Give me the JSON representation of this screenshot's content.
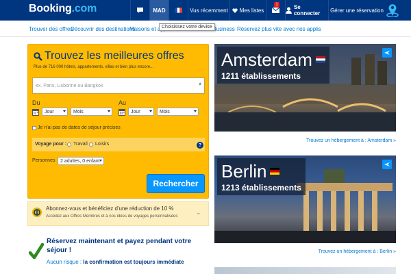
{
  "header": {
    "logo_main": "Booking",
    "logo_suffix": ".com",
    "currency": "MAD",
    "recent": "Vus récemment",
    "lists": "Mes listes",
    "inbox_count": "1",
    "login": "Se connecter",
    "manage": "Gérer une réservation"
  },
  "subnav": {
    "items": [
      "Trouver des offres",
      "Découvrir des destinations",
      "Maisons et app",
      "com Business",
      "Réservez plus vite avec nos applis"
    ],
    "tooltip": "Choisissez votre devise"
  },
  "search": {
    "title": "Trouvez les meilleures offres",
    "subtitle": "Plus de 716 000 hôtels, appartements, villas et bien plus encore...",
    "destination_placeholder": "ex. Paris, Lisbonne ou Bangkok",
    "required_mark": "*",
    "checkin_label": "Du",
    "checkout_label": "Au",
    "day_label": "Jour",
    "month_label": "Mois",
    "no_dates_label": "Je n'ai pas de dates de séjour précises",
    "travel_purpose_label": "Voyage pour :",
    "purpose_work": "Travail",
    "purpose_leisure": "Loisirs",
    "help": "?",
    "persons_label": "Personnes",
    "persons_value": "2 adultes, 0 enfant",
    "submit_label": "Rechercher"
  },
  "member": {
    "title": "Abonnez-vous et bénéficiez d'une réduction de 10 %",
    "subtitle": "Accédez aux Offres Membres et à nos idées de voyages personnalisées",
    "chevron": "⌄"
  },
  "reserve": {
    "title": "Réservez maintenant et payez pendant votre séjour !",
    "sub_prefix": "Aucun risque :",
    "sub_bold": "la confirmation est toujours immédiate"
  },
  "cities": [
    {
      "name": "Amsterdam",
      "count": "1211 établissements",
      "link": "Trouvez un hébergement à : Amsterdam »"
    },
    {
      "name": "Berlin",
      "count": "1213 établissements",
      "link": "Trouvez un hébergement à : Berlin »"
    }
  ],
  "colors": {
    "brand": "#003580",
    "search_bg": "#febb02",
    "button": "#0896ff",
    "link": "#0077cc"
  }
}
